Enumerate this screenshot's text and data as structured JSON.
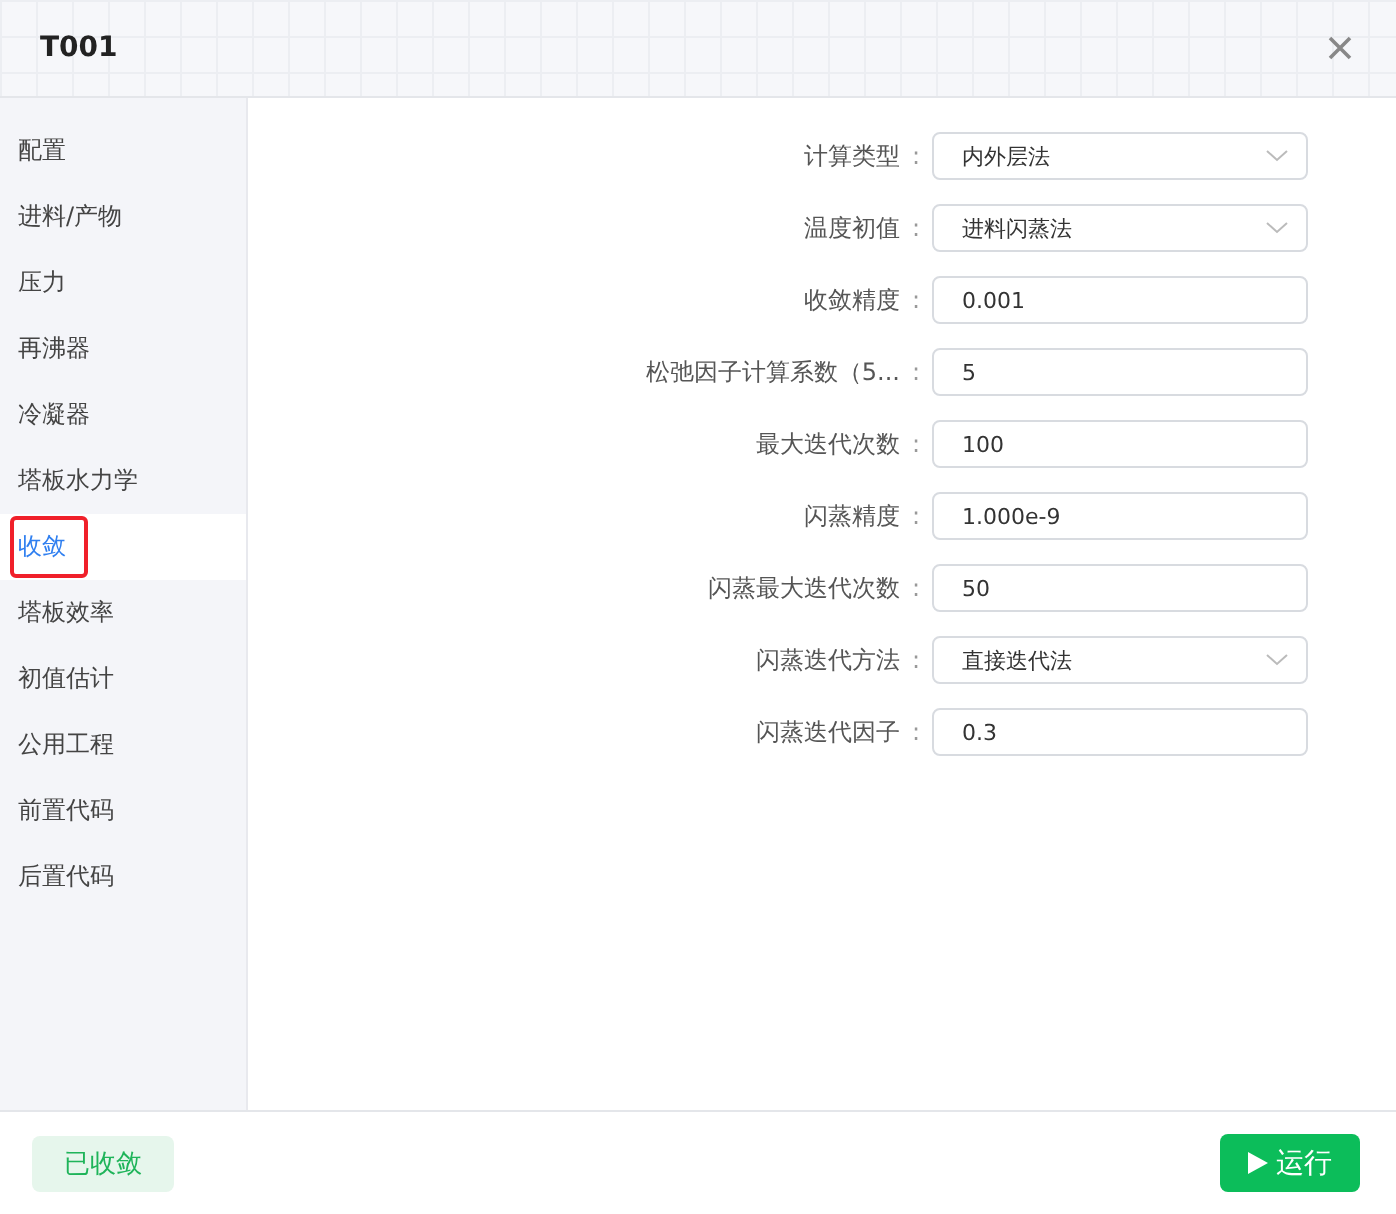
{
  "window": {
    "title": "T001"
  },
  "sidebar": {
    "items": [
      {
        "label": "配置",
        "selected": false
      },
      {
        "label": "进料/产物",
        "selected": false
      },
      {
        "label": "压力",
        "selected": false
      },
      {
        "label": "再沸器",
        "selected": false
      },
      {
        "label": "冷凝器",
        "selected": false
      },
      {
        "label": "塔板水力学",
        "selected": false
      },
      {
        "label": "收敛",
        "selected": true
      },
      {
        "label": "塔板效率",
        "selected": false
      },
      {
        "label": "初值估计",
        "selected": false
      },
      {
        "label": "公用工程",
        "selected": false
      },
      {
        "label": "前置代码",
        "selected": false
      },
      {
        "label": "后置代码",
        "selected": false
      }
    ]
  },
  "form": {
    "separator": ":",
    "fields": [
      {
        "label": "计算类型",
        "kind": "select",
        "value": "内外层法"
      },
      {
        "label": "温度初值",
        "kind": "select",
        "value": "进料闪蒸法"
      },
      {
        "label": "收敛精度",
        "kind": "input",
        "value": "0.001"
      },
      {
        "label": "松弛因子计算系数（5...",
        "kind": "input",
        "value": "5"
      },
      {
        "label": "最大迭代次数",
        "kind": "input",
        "value": "100"
      },
      {
        "label": "闪蒸精度",
        "kind": "input",
        "value": "1.000e-9"
      },
      {
        "label": "闪蒸最大迭代次数",
        "kind": "input",
        "value": "50"
      },
      {
        "label": "闪蒸迭代方法",
        "kind": "select",
        "value": "直接迭代法"
      },
      {
        "label": "闪蒸迭代因子",
        "kind": "input",
        "value": "0.3"
      }
    ]
  },
  "footer": {
    "status": "已收敛",
    "run_button": "运行"
  }
}
